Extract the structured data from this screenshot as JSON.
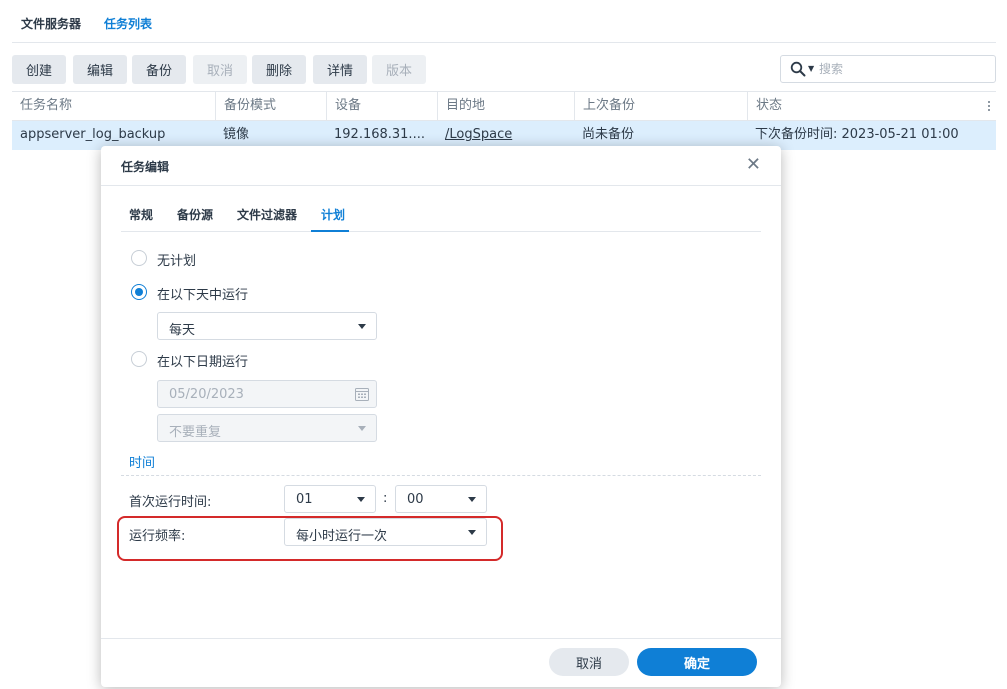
{
  "top_tabs": [
    {
      "label": "文件服务器"
    },
    {
      "label": "任务列表"
    }
  ],
  "toolbar": {
    "create": "创建",
    "edit": "编辑",
    "backup": "备份",
    "cancel": "取消",
    "delete": "删除",
    "details": "详情",
    "version": "版本"
  },
  "search": {
    "placeholder": "搜索"
  },
  "grid": {
    "columns": [
      "任务名称",
      "备份模式",
      "设备",
      "目的地",
      "上次备份",
      "状态"
    ],
    "rows": [
      {
        "name": "appserver_log_backup",
        "mode": "镜像",
        "device": "192.168.31....",
        "destination": "/LogSpace",
        "last_backup": "尚未备份",
        "status": "下次备份时间: 2023-05-21 01:00"
      }
    ]
  },
  "dialog": {
    "title": "任务编辑",
    "tabs": [
      "常规",
      "备份源",
      "文件过滤器",
      "计划"
    ],
    "active_tab": "计划",
    "schedule": {
      "no_schedule": "无计划",
      "run_on_days": "在以下天中运行",
      "day_value": "每天",
      "run_on_date": "在以下日期运行",
      "date_value": "05/20/2023",
      "repeat_value": "不要重复"
    },
    "time": {
      "section_title": "时间",
      "first_run_label": "首次运行时间:",
      "hour": "01",
      "minute": "00",
      "frequency_label": "运行频率:",
      "frequency_value": "每小时运行一次"
    },
    "footer": {
      "cancel": "取消",
      "ok": "确定"
    }
  },
  "colors": {
    "accent": "#0f7fd6",
    "highlight": "#d42a2a",
    "selected_row": "#dceefd"
  }
}
